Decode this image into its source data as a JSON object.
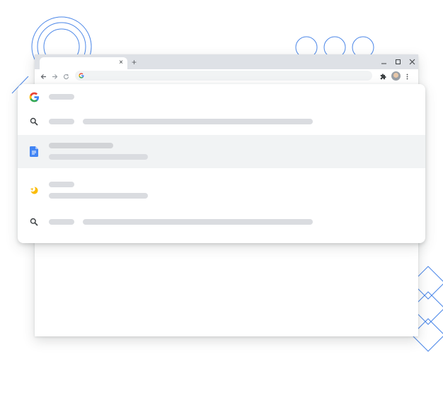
{
  "browser": {
    "tab_close_glyph": "×",
    "new_tab_glyph": "+",
    "window_buttons": [
      "minimize-icon",
      "maximize-icon",
      "close-icon"
    ],
    "toolbar_icons": [
      "back-arrow-icon",
      "forward-arrow-icon",
      "reload-icon",
      "extensions-icon",
      "profile-avatar",
      "more-vert-icon"
    ],
    "omnibox_icon": "google-g-icon"
  },
  "dropdown": {
    "suggestions": [
      {
        "icon": "google-g-icon",
        "selected": false
      },
      {
        "icon": "search-icon",
        "selected": false
      },
      {
        "icon": "google-docs-icon",
        "selected": true
      },
      {
        "icon": "history-moon-icon",
        "selected": false
      },
      {
        "icon": "search-icon",
        "selected": false
      }
    ]
  },
  "colors": {
    "accent_blue": "#4285f4",
    "placeholder_bar": "#dadce0",
    "selected_row": "#f1f3f4",
    "tab_strip": "#dee1e6",
    "decoration_blue": "#4285f4",
    "history_icon_yellow": "#fbbc04"
  }
}
